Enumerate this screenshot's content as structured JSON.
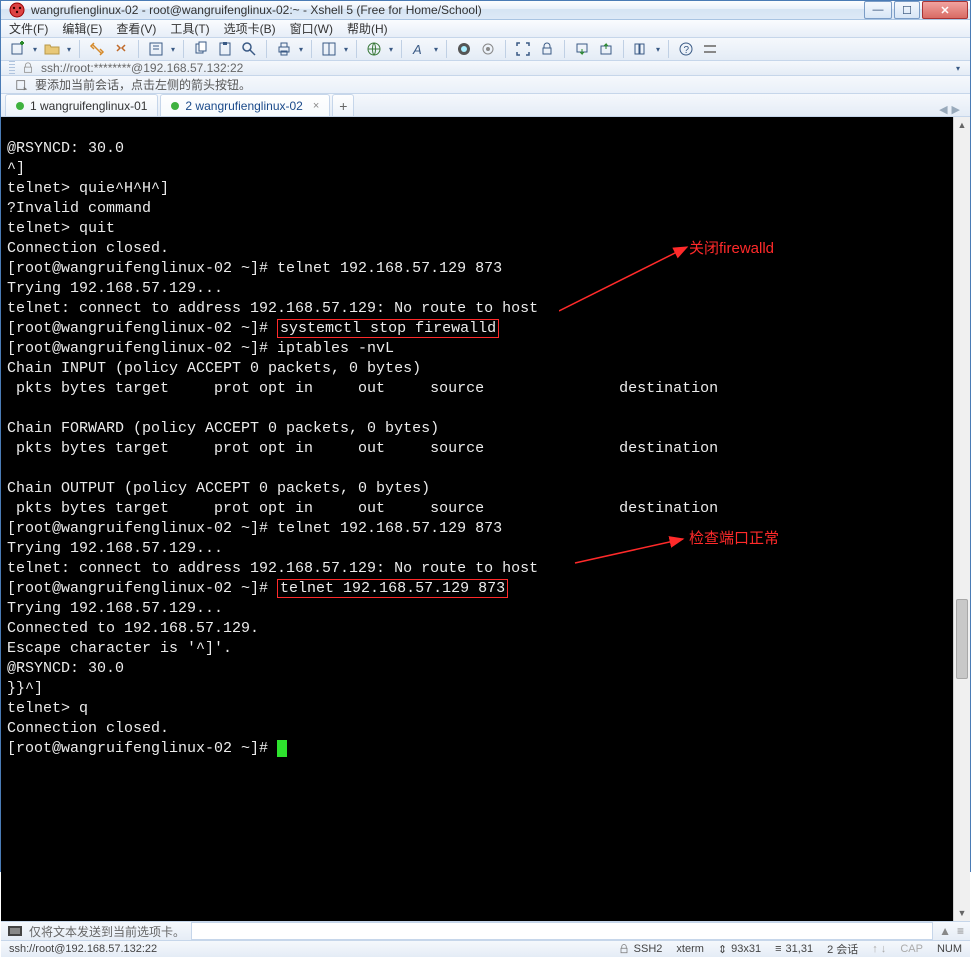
{
  "window": {
    "title": "wangrufienglinux-02 - root@wangruifenglinux-02:~ - Xshell 5 (Free for Home/School)"
  },
  "menu": {
    "file": "文件(F)",
    "edit": "编辑(E)",
    "view": "查看(V)",
    "tools": "工具(T)",
    "tabs": "选项卡(B)",
    "window": "窗口(W)",
    "help": "帮助(H)"
  },
  "address": {
    "text": "ssh://root:********@192.168.57.132:22"
  },
  "hint": {
    "text": "要添加当前会话，点击左侧的箭头按钮。"
  },
  "tabs": {
    "items": [
      {
        "label": "1 wangruifenglinux-01",
        "active": false
      },
      {
        "label": "2 wangrufienglinux-02",
        "active": true
      }
    ]
  },
  "terminal": {
    "lines": [
      "@RSYNCD: 30.0",
      "^]",
      "telnet> quie^H^H^]",
      "?Invalid command",
      "telnet> quit",
      "Connection closed.",
      "[root@wangruifenglinux-02 ~]# telnet 192.168.57.129 873",
      "Trying 192.168.57.129...",
      "telnet: connect to address 192.168.57.129: No route to host",
      "[root@wangruifenglinux-02 ~]# ",
      "systemctl stop firewalld",
      "[root@wangruifenglinux-02 ~]# iptables -nvL",
      "Chain INPUT (policy ACCEPT 0 packets, 0 bytes)",
      " pkts bytes target     prot opt in     out     source               destination",
      "",
      "Chain FORWARD (policy ACCEPT 0 packets, 0 bytes)",
      " pkts bytes target     prot opt in     out     source               destination",
      "",
      "Chain OUTPUT (policy ACCEPT 0 packets, 0 bytes)",
      " pkts bytes target     prot opt in     out     source               destination",
      "[root@wangruifenglinux-02 ~]# telnet 192.168.57.129 873",
      "Trying 192.168.57.129...",
      "telnet: connect to address 192.168.57.129: No route to host",
      "[root@wangruifenglinux-02 ~]# ",
      "telnet 192.168.57.129 873",
      "Trying 192.168.57.129...",
      "Connected to 192.168.57.129.",
      "Escape character is '^]'.",
      "@RSYNCD: 30.0",
      "}}^]",
      "telnet> q",
      "Connection closed.",
      "[root@wangruifenglinux-02 ~]# "
    ],
    "annotations": {
      "a1": "关闭firewalld",
      "a2": "检查端口正常"
    }
  },
  "sendbar": {
    "label": "仅将文本发送到当前选项卡。"
  },
  "status": {
    "conn": "ssh://root@192.168.57.132:22",
    "ssh": "SSH2",
    "term": "xterm",
    "size": "93x31",
    "pos": "31,31",
    "sessions": "2 会话",
    "cap": "CAP",
    "num": "NUM"
  },
  "colors": {
    "annot_red": "#ff2a2a"
  }
}
